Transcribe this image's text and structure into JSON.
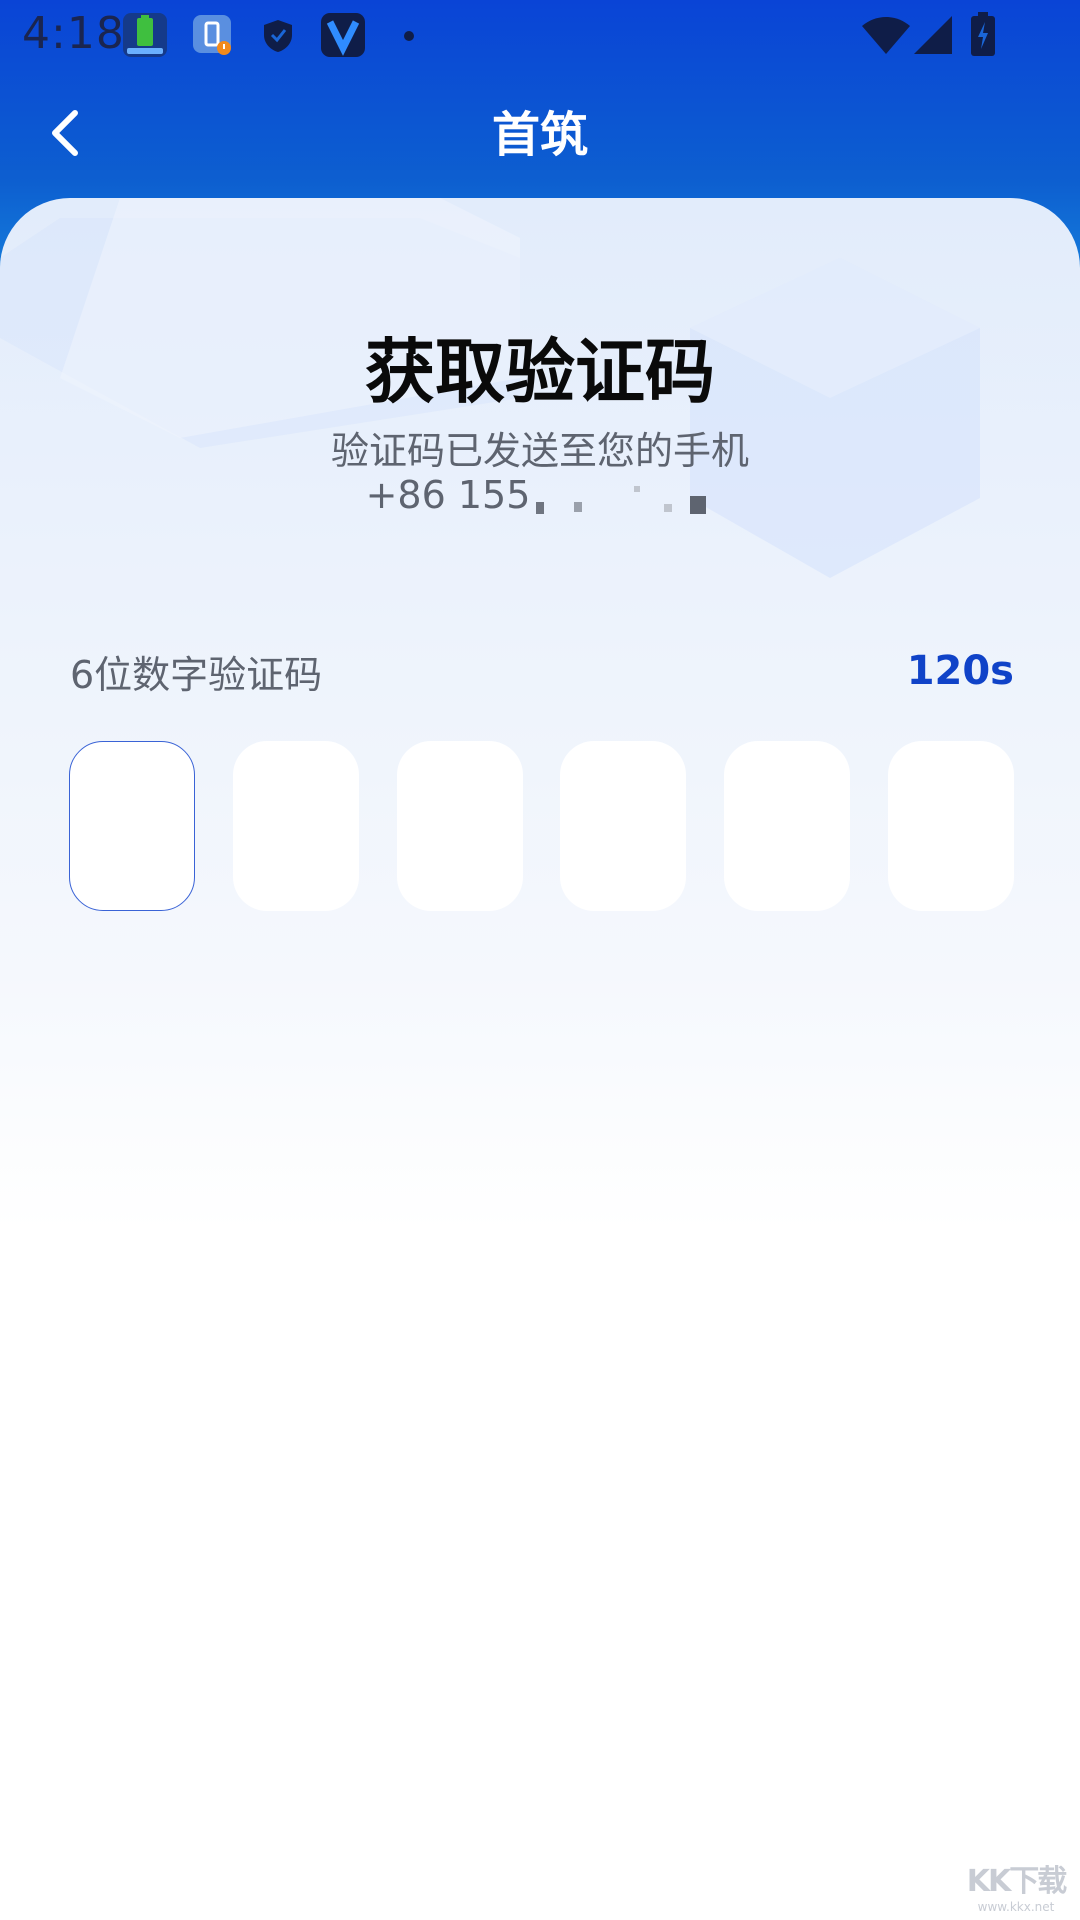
{
  "status_bar": {
    "time": "4:18",
    "icons": [
      "battery-app-icon",
      "battery-alert-icon",
      "shield-icon",
      "v-app-icon",
      "dot-icon",
      "wifi-icon",
      "signal-icon",
      "battery-charging-icon"
    ]
  },
  "nav": {
    "title": "首筑",
    "back_icon": "chevron-left-icon"
  },
  "verification": {
    "headline": "获取验证码",
    "subtitle": "验证码已发送至您的手机",
    "phone_prefix": "+86 155",
    "code_label": "6位数字验证码",
    "countdown": "120s",
    "code_digits": [
      "",
      "",
      "",
      "",
      "",
      ""
    ],
    "active_index": 0
  },
  "watermark": {
    "logo": "KK下载",
    "url": "www.kkx.net"
  },
  "colors": {
    "header_blue": "#0a44d6",
    "accent": "#1043c8",
    "active_border": "#3a63d6"
  }
}
